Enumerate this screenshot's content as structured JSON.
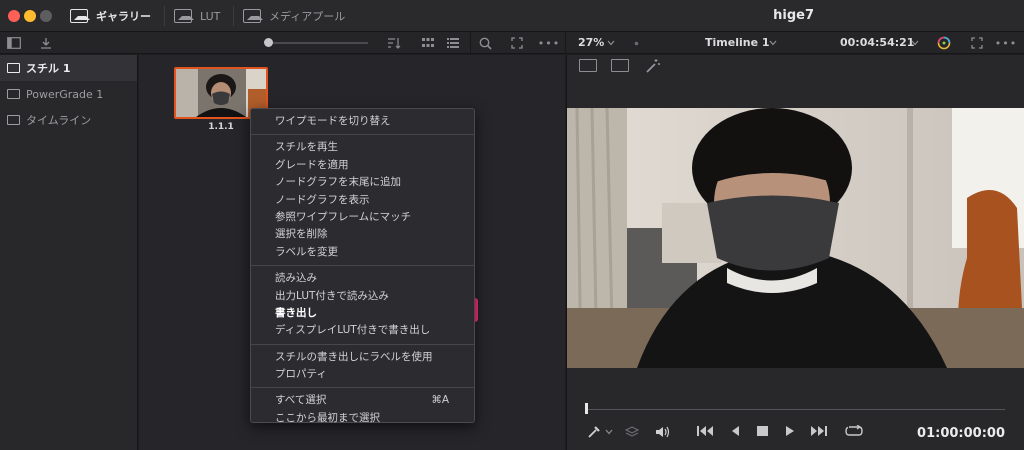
{
  "titlebar": {
    "tabs": [
      {
        "label": "ギャラリー",
        "icon": "gallery-icon",
        "active": true
      },
      {
        "label": "LUT",
        "icon": "lut-icon",
        "active": false
      },
      {
        "label": "メディアプール",
        "icon": "media-pool-icon",
        "active": false
      }
    ],
    "project_title": "hige7"
  },
  "toolbar": {
    "zoom": "27%",
    "timeline_name": "Timeline 1",
    "timecode": "00:04:54:21"
  },
  "albums": [
    {
      "label": "スチル 1",
      "active": true
    },
    {
      "label": "PowerGrade 1",
      "active": false
    },
    {
      "label": "タイムライン",
      "active": false
    }
  ],
  "gallery": {
    "still_label": "1.1.1"
  },
  "context_menu": {
    "groups": [
      [
        {
          "label": "ワイプモードを切り替え"
        }
      ],
      [
        {
          "label": "スチルを再生"
        },
        {
          "label": "グレードを適用"
        },
        {
          "label": "ノードグラフを末尾に追加"
        },
        {
          "label": "ノードグラフを表示"
        },
        {
          "label": "参照ワイプフレームにマッチ"
        },
        {
          "label": "選択を削除"
        },
        {
          "label": "ラベルを変更"
        }
      ],
      [
        {
          "label": "読み込み"
        },
        {
          "label": "出力LUT付きで読み込み"
        },
        {
          "label": "書き出し",
          "highlight": true
        },
        {
          "label": "ディスプレイLUT付きで書き出し"
        }
      ],
      [
        {
          "label": "スチルの書き出しにラベルを使用"
        },
        {
          "label": "プロパティ"
        }
      ],
      [
        {
          "label": "すべて選択",
          "shortcut": "⌘A"
        },
        {
          "label": "ここから最初まで選択"
        }
      ]
    ],
    "highlight_color": "#ff2d78"
  },
  "viewer": {
    "timecode": "01:00:00:00"
  }
}
